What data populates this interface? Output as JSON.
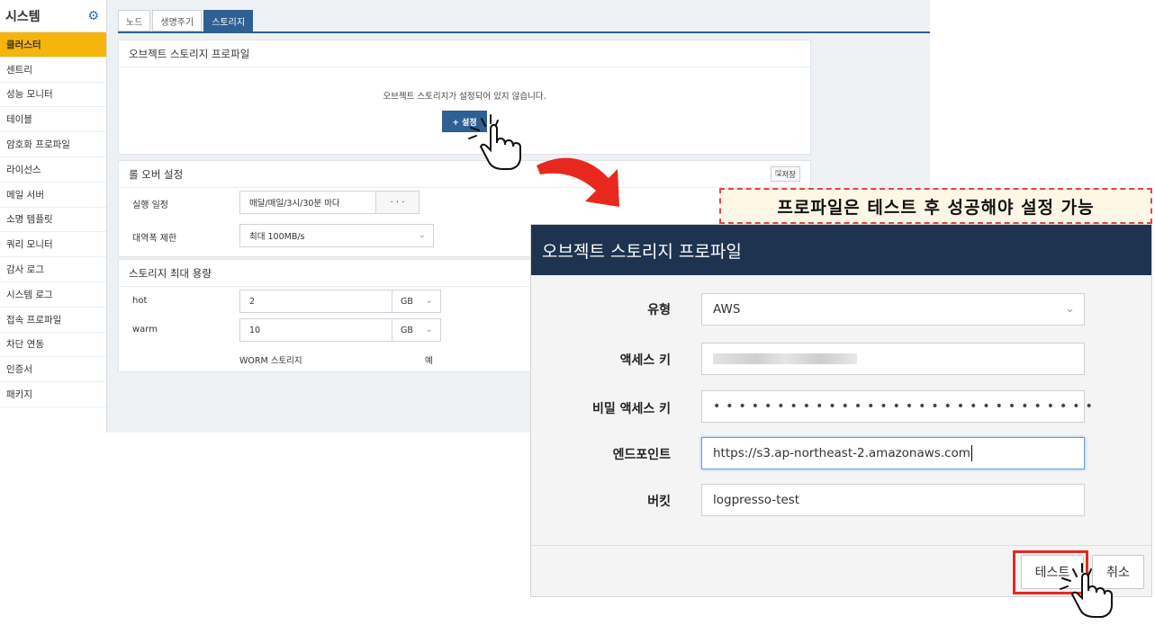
{
  "sidebar": {
    "title": "시스템",
    "items": [
      "클러스터",
      "센트리",
      "성능 모니터",
      "테이블",
      "암호화 프로파일",
      "라이선스",
      "메일 서버",
      "소명 템플릿",
      "쿼리 모니터",
      "감사 로그",
      "시스템 로그",
      "접속 프로파일",
      "차단 연동",
      "인증서",
      "패키지"
    ],
    "active_index": 0
  },
  "tabs": [
    "노드",
    "생명주기",
    "스토리지"
  ],
  "active_tab": 2,
  "storage_profile": {
    "title": "오브젝트 스토리지 프로파일",
    "message": "오브젝트 스토리지가 설정되어 있지 않습니다.",
    "set_button": "+ 설정"
  },
  "rollover": {
    "title": "롤 오버 설정",
    "save_button": "저장",
    "schedule_label": "실행 일정",
    "schedule_value": "매달/매일/3시/30분 마다",
    "schedule_more": "· · ·",
    "bandwidth_label": "대역폭 제한",
    "bandwidth_value": "최대 100MB/s"
  },
  "capacity": {
    "title": "스토리지 최대 용량",
    "hot_label": "hot",
    "hot_value": "2",
    "hot_unit": "GB",
    "warm_label": "warm",
    "warm_value": "10",
    "warm_unit": "GB",
    "worm_label": "WORM 스토리지",
    "worm_value": "예"
  },
  "callout": "프로파일은 테스트 후 성공해야 설정 가능",
  "modal": {
    "title": "오브젝트 스토리지 프로파일",
    "type_label": "유형",
    "type_value": "AWS",
    "access_key_label": "액세스 키",
    "secret_key_label": "비밀 액세스 키",
    "secret_key_value": "••••••••••••••••••••••••••••••",
    "endpoint_label": "엔드포인트",
    "endpoint_value": "https://s3.ap-northeast-2.amazonaws.com",
    "bucket_label": "버킷",
    "bucket_value": "logpresso-test",
    "test_button": "테스트",
    "cancel_button": "취소"
  },
  "colors": {
    "accent": "#2f5f93",
    "active_sidebar": "#f5b50a",
    "modal_header": "#1d3350",
    "highlight": "#e8281f"
  }
}
